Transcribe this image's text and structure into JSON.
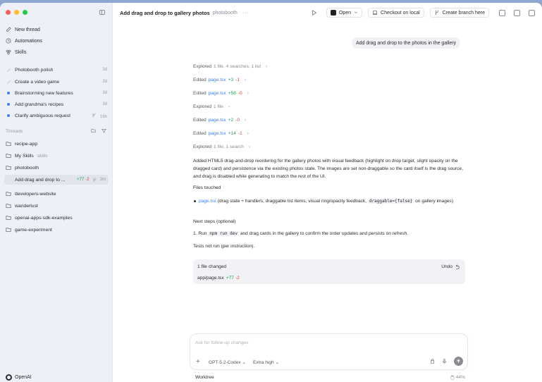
{
  "header": {
    "title": "Add drag and drop to gallery photos",
    "project": "photobooth",
    "more": "···",
    "open_label": "Open",
    "checkout_label": "Checkout on local",
    "branch_label": "Create branch here"
  },
  "sidebar": {
    "nav": [
      {
        "label": "New thread",
        "icon": "compose-icon"
      },
      {
        "label": "Automations",
        "icon": "clock-icon"
      },
      {
        "label": "Skills",
        "icon": "skills-icon"
      }
    ],
    "recent": [
      {
        "title": "Photobooth polish",
        "age": "3d",
        "state": "idle"
      },
      {
        "title": "Create a video game",
        "age": "2d",
        "state": "idle"
      },
      {
        "title": "Brainstorming new features",
        "age": "3d",
        "state": "unread"
      },
      {
        "title": "Add grandma's recipes",
        "age": "3d",
        "state": "unread"
      },
      {
        "title": "Clarify ambiguous request",
        "age": "16h",
        "state": "unread"
      }
    ],
    "threads_label": "Threads",
    "folders": [
      {
        "name": "recipe-app"
      },
      {
        "name": "My Skills",
        "tag": "skills"
      },
      {
        "name": "photobooth"
      }
    ],
    "active_thread": {
      "title": "Add drag and drop to ...",
      "added": "+77",
      "removed": "-2",
      "age": "3m"
    },
    "folders_after": [
      {
        "name": "developers-website"
      },
      {
        "name": "wanderlust"
      },
      {
        "name": "openai-apps-sdk-examples"
      },
      {
        "name": "game-experiment"
      }
    ],
    "org_name": "OpenAI"
  },
  "conversation": {
    "user_message": "Add drag and drop to the photos in the gallery",
    "activity": [
      {
        "verb": "Explored",
        "detail": "1 file, 4 searches, 1 list"
      },
      {
        "verb": "Edited",
        "file": "page.tsx",
        "added": "+3",
        "removed": "-1"
      },
      {
        "verb": "Edited",
        "file": "page.tsx",
        "added": "+58",
        "removed": "-0"
      },
      {
        "verb": "Explored",
        "detail": "1 file"
      },
      {
        "verb": "Edited",
        "file": "page.tsx",
        "added": "+2",
        "removed": "-0"
      },
      {
        "verb": "Edited",
        "file": "page.tsx",
        "added": "+14",
        "removed": "-1"
      },
      {
        "verb": "Explored",
        "detail": "1 file, 1 search"
      }
    ],
    "summary": "Added HTML5 drag-and-drop reordering for the gallery photos with visual feedback (highlight on drop target, slight opacity on the dragged card) and persistence via the existing photos state. The images are set non-draggable so the card itself is the drag source, and drag is disabled while generating to match the rest of the UI.",
    "files_heading": "Files touched",
    "file_item": {
      "file": "page.tsx",
      "text_before": " (drag state + handlers, draggable list items, visual ring/opacity feedback, ",
      "code": "draggable={false}",
      "text_after": " on gallery images)"
    },
    "next_heading": "Next steps (optional)",
    "next_step": {
      "prefix": "1. Run ",
      "code": "npm run dev",
      "suffix": " and drag cards in the gallery to confirm the order updates and persists on refresh."
    },
    "tests_note": "Tests not run (per instruction).",
    "changes": {
      "header": "1 file changed",
      "undo_label": "Undo",
      "file": "app/page.tsx",
      "added": "+77",
      "removed": "-2"
    }
  },
  "composer": {
    "placeholder": "Ask for follow-up changes",
    "model": "GPT-5.2-Codex",
    "reasoning": "Extra high"
  },
  "footer": {
    "env": "Worktree",
    "percent": "44%"
  }
}
